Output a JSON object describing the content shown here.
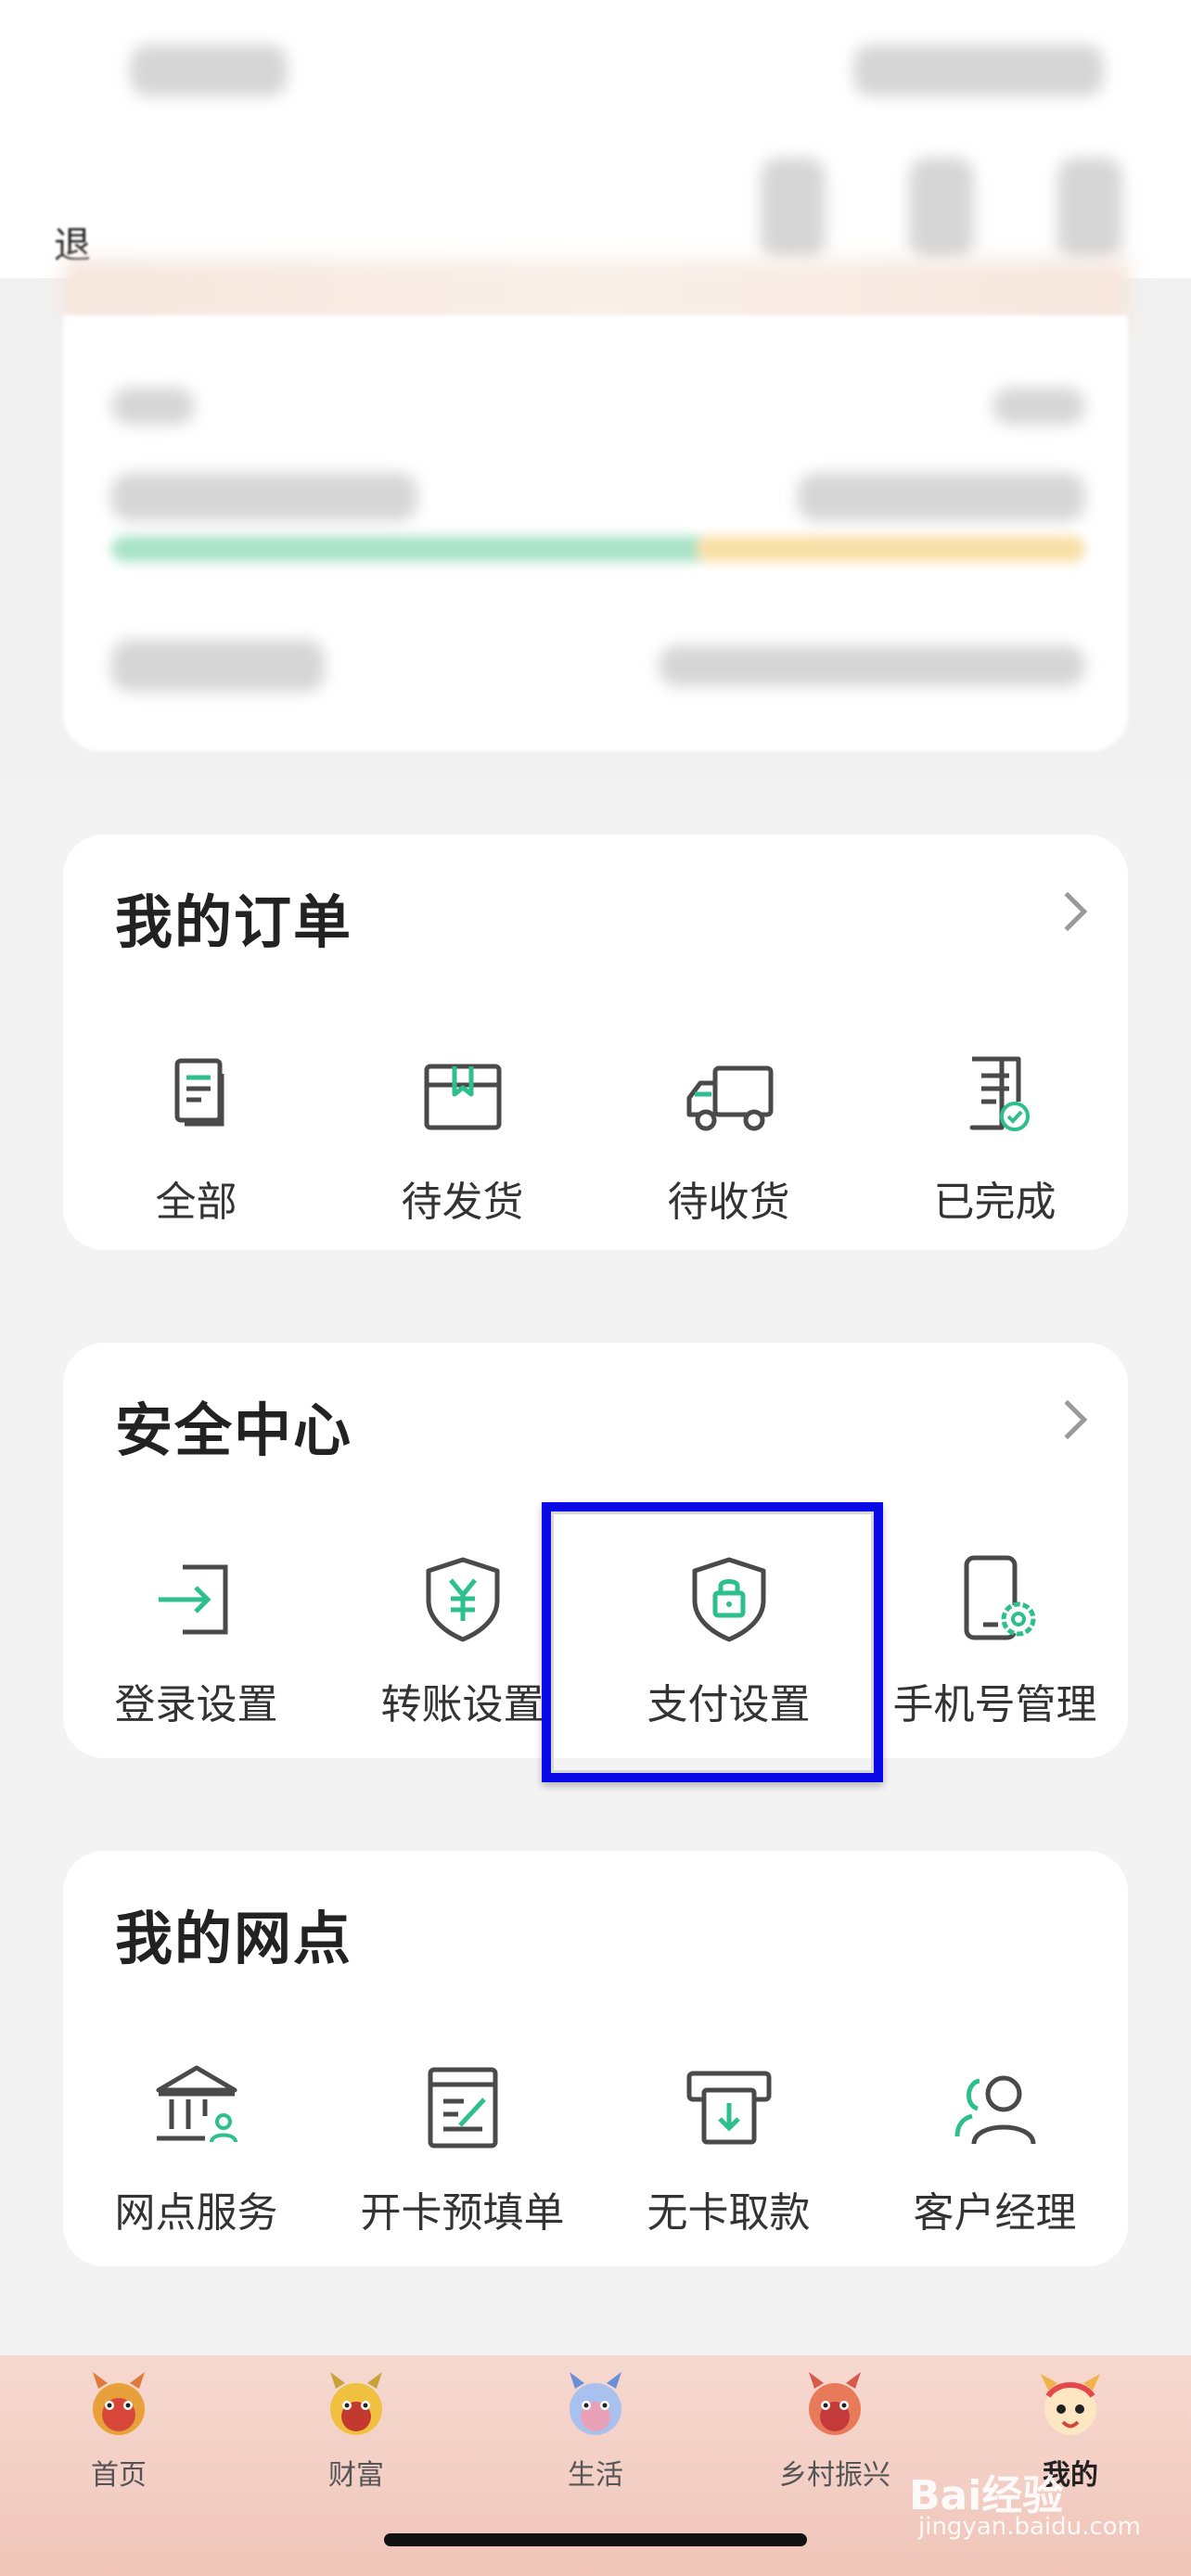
{
  "top_left_partial": "退",
  "orders": {
    "title": "我的订单",
    "items": [
      {
        "label": "全部",
        "icon": "document-list-icon"
      },
      {
        "label": "待发货",
        "icon": "package-box-icon"
      },
      {
        "label": "待收货",
        "icon": "delivery-truck-icon"
      },
      {
        "label": "已完成",
        "icon": "document-check-icon"
      }
    ]
  },
  "security": {
    "title": "安全中心",
    "items": [
      {
        "label": "登录设置",
        "icon": "login-arrow-icon"
      },
      {
        "label": "转账设置",
        "icon": "shield-yen-icon"
      },
      {
        "label": "支付设置",
        "icon": "shield-lock-icon"
      },
      {
        "label": "手机号管理",
        "icon": "phone-gear-icon"
      }
    ]
  },
  "outlets": {
    "title": "我的网点",
    "items": [
      {
        "label": "网点服务",
        "icon": "bank-building-icon"
      },
      {
        "label": "开卡预填单",
        "icon": "edit-form-icon"
      },
      {
        "label": "无卡取款",
        "icon": "atm-withdraw-icon"
      },
      {
        "label": "客户经理",
        "icon": "customer-manager-icon"
      }
    ]
  },
  "tabbar": {
    "tabs": [
      {
        "label": "首页",
        "active": false
      },
      {
        "label": "财富",
        "active": false
      },
      {
        "label": "生活",
        "active": false
      },
      {
        "label": "乡村振兴",
        "active": false
      },
      {
        "label": "我的",
        "active": true
      }
    ]
  },
  "watermark": {
    "brand": "Bai经验",
    "url": "jingyan.baidu.com"
  },
  "colors": {
    "accent_green": "#2dbf8e",
    "icon_gray": "#4a4a4a",
    "highlight_blue": "#0a0ae8"
  }
}
